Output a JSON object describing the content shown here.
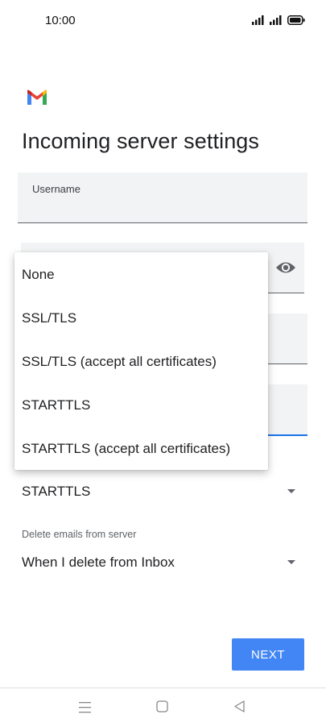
{
  "status_bar": {
    "time": "10:00"
  },
  "header": {
    "title": "Incoming server settings"
  },
  "fields": {
    "username_label": "Username"
  },
  "security": {
    "selected": "STARTTLS",
    "options": [
      "None",
      "SSL/TLS",
      "SSL/TLS (accept all certificates)",
      "STARTTLS",
      "STARTTLS (accept all certificates)"
    ]
  },
  "delete_emails": {
    "caption": "Delete emails from server",
    "selected": "When I delete from Inbox"
  },
  "actions": {
    "next_label": "NEXT"
  },
  "icons": {
    "logo": "gmail-logo-icon",
    "password_toggle": "eye-icon",
    "nav": [
      "menu-icon",
      "home-square-icon",
      "back-triangle-icon"
    ]
  },
  "colors": {
    "accent": "#1a73e8",
    "button": "#4285f4",
    "field_bg": "#f1f3f4",
    "text": "#202124"
  }
}
